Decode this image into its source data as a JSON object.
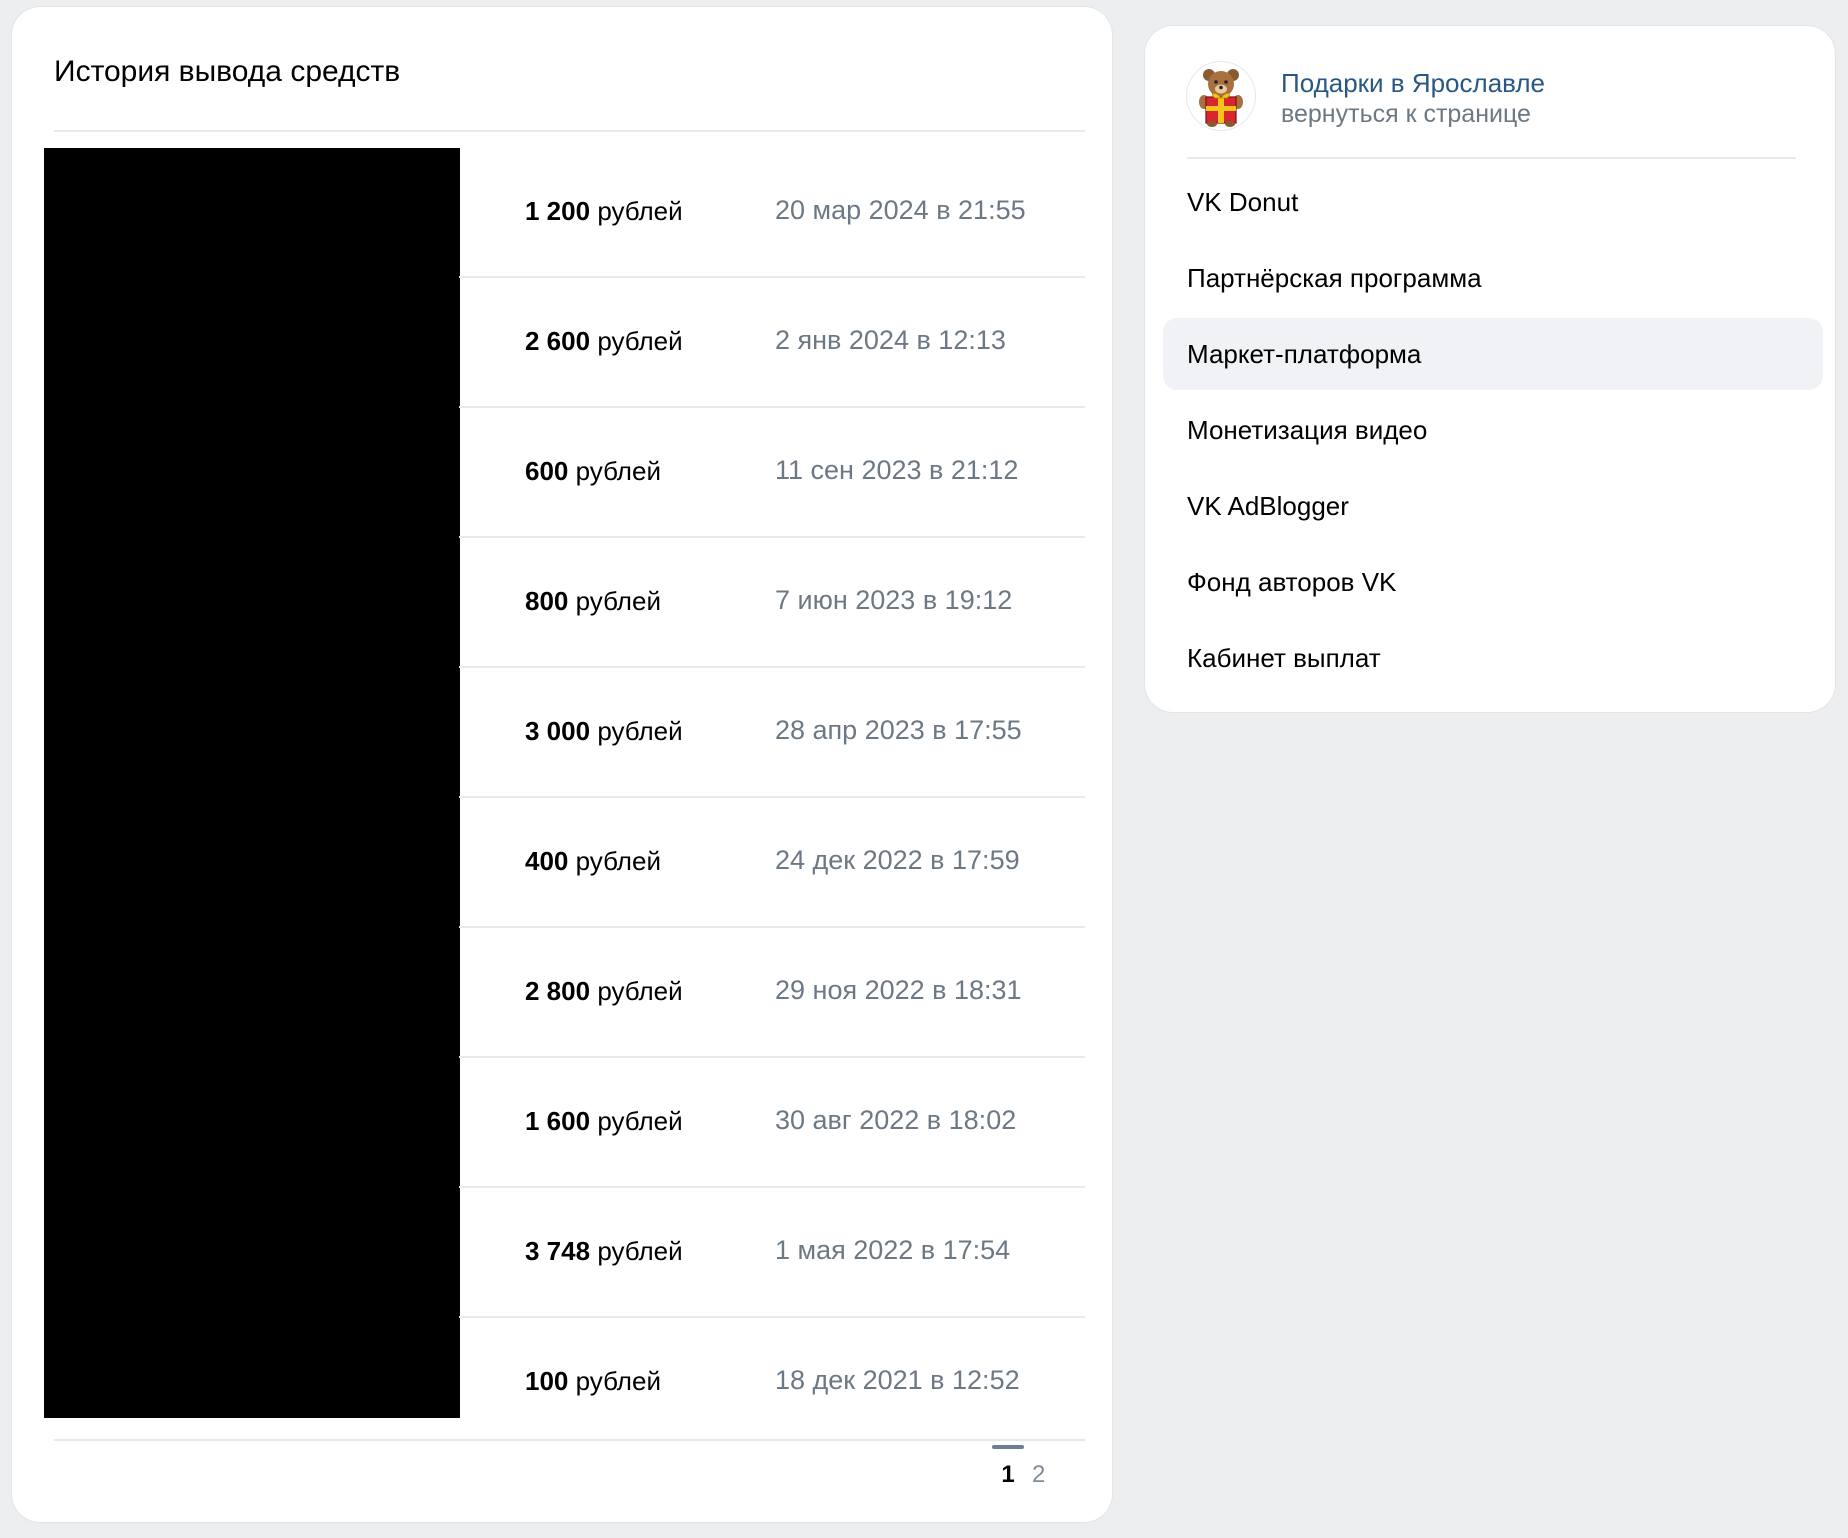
{
  "history": {
    "title": "История вывода средств",
    "rows": [
      {
        "amount": "1 200",
        "unit": "рублей",
        "date": "20 мар 2024 в 21:55"
      },
      {
        "amount": "2 600",
        "unit": "рублей",
        "date": "2 янв 2024 в 12:13"
      },
      {
        "amount": "600",
        "unit": "рублей",
        "date": "11 сен 2023 в 21:12"
      },
      {
        "amount": "800",
        "unit": "рублей",
        "date": "7 июн 2023 в 19:12"
      },
      {
        "amount": "3 000",
        "unit": "рублей",
        "date": "28 апр 2023 в 17:55"
      },
      {
        "amount": "400",
        "unit": "рублей",
        "date": "24 дек 2022 в 17:59"
      },
      {
        "amount": "2 800",
        "unit": "рублей",
        "date": "29 ноя 2022 в 18:31"
      },
      {
        "amount": "1 600",
        "unit": "рублей",
        "date": "30 авг 2022 в 18:02"
      },
      {
        "amount": "3 748",
        "unit": "рублей",
        "date": "1 мая 2022 в 17:54"
      },
      {
        "amount": "100",
        "unit": "рублей",
        "date": "18 дек 2021 в 12:52"
      }
    ],
    "pagination": {
      "current": "1",
      "next": "2"
    }
  },
  "sidebar": {
    "group_name": "Подарки в Ярославле",
    "back_link": "вернуться к странице",
    "avatar_icon": "gift-bear-icon",
    "items": [
      {
        "label": "VK Donut"
      },
      {
        "label": "Партнёрская программа"
      },
      {
        "label": "Маркет-платформа",
        "active": true
      },
      {
        "label": "Монетизация видео"
      },
      {
        "label": "VK AdBlogger"
      },
      {
        "label": "Фонд авторов VK"
      },
      {
        "label": "Кабинет выплат"
      }
    ]
  },
  "colors": {
    "background": "#edeef0",
    "link": "#2a5885",
    "secondary_text": "#6d7885",
    "active_item_bg": "#f0f2f5"
  }
}
